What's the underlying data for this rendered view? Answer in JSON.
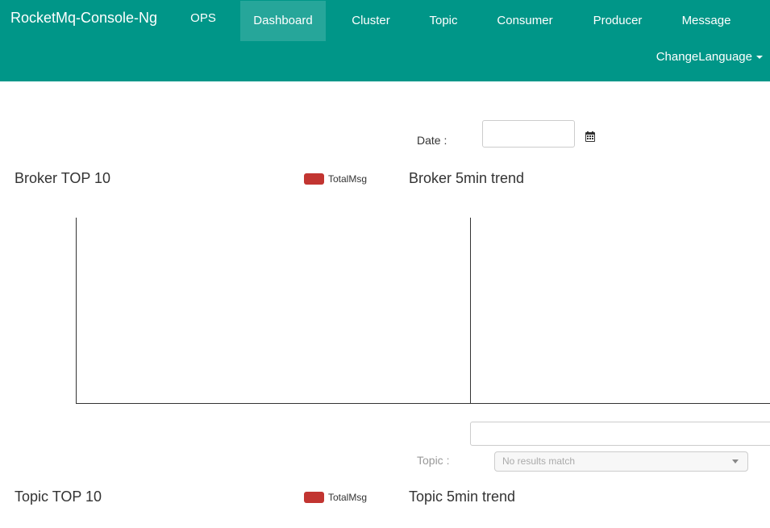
{
  "app": {
    "brand": "RocketMq-Console-Ng"
  },
  "nav": {
    "items": [
      {
        "label": "OPS"
      },
      {
        "label": "Dashboard",
        "active": true
      },
      {
        "label": "Cluster"
      },
      {
        "label": "Topic"
      },
      {
        "label": "Consumer"
      },
      {
        "label": "Producer"
      },
      {
        "label": "Message"
      }
    ],
    "language_label": "ChangeLanguage"
  },
  "filters": {
    "date_label": "Date :",
    "date_value": "",
    "topic_label": "Topic :",
    "topic_input_value": "",
    "topic_select_text": "No results match"
  },
  "broker": {
    "top_title": "Broker TOP 10",
    "legend_label": "TotalMsg",
    "trend_title": "Broker 5min trend"
  },
  "topic": {
    "top_title": "Topic TOP 10",
    "legend_label": "TotalMsg",
    "trend_title": "Topic 5min trend"
  },
  "colors": {
    "navbar": "#009688",
    "nav_active": "#26a69a",
    "legend_series": "#c23531"
  },
  "icons": {
    "calendar": "calendar-icon",
    "language_caret": "caret-down-icon",
    "select_arrow": "triangle-down-icon"
  }
}
